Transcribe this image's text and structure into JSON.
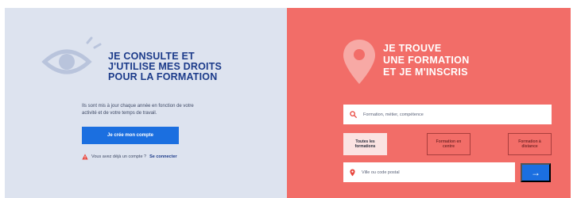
{
  "left": {
    "heading_line1": "JE CONSULTE ET",
    "heading_line2": "J'UTILISE MES DROITS",
    "heading_line3": "POUR LA FORMATION",
    "description": "Ils sont mis à jour chaque année en fonction de votre activité et de votre temps de travail.",
    "create_button": "Je crée mon compte",
    "already_text": "Vous avez déjà un compte ?",
    "connect_link": "Se connecter",
    "icon": "eye-icon"
  },
  "right": {
    "heading_line1": "JE TROUVE",
    "heading_line2": "UNE FORMATION",
    "heading_line3": "ET JE M'INSCRIS",
    "search_placeholder": "Formation, métier, compétence",
    "filters": [
      {
        "line1": "Toutes les",
        "line2": "formations"
      },
      {
        "line1": "Formation en",
        "line2": "centre"
      },
      {
        "line1": "Formation à",
        "line2": "distance"
      }
    ],
    "location_placeholder": "Ville ou code postal",
    "go_button": "→",
    "icon": "location-pin-icon"
  },
  "colors": {
    "left_bg": "#dde3ef",
    "right_bg": "#f26d68",
    "primary_blue": "#1b6fe0",
    "navy": "#1c3b8a"
  }
}
